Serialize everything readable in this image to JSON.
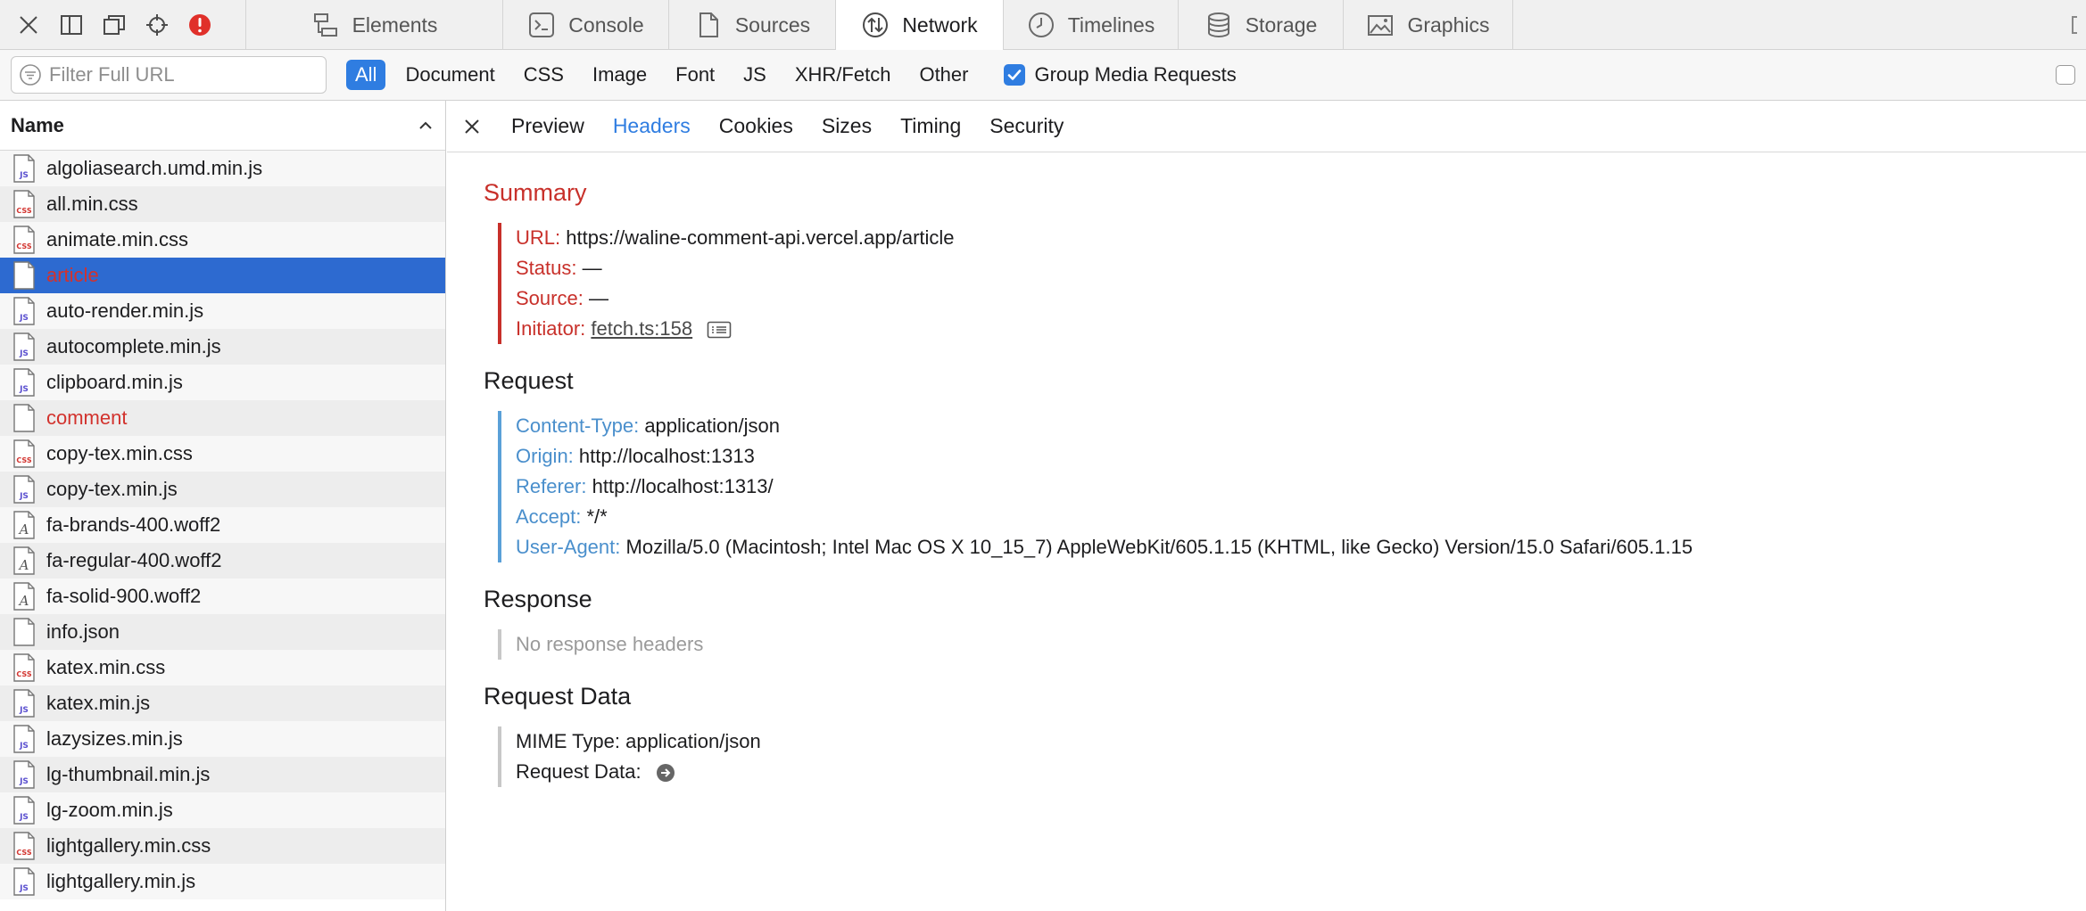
{
  "toolbar": {
    "tabs": [
      {
        "label": "Elements",
        "icon": "elements-icon"
      },
      {
        "label": "Console",
        "icon": "console-icon"
      },
      {
        "label": "Sources",
        "icon": "sources-icon"
      },
      {
        "label": "Network",
        "icon": "network-icon"
      },
      {
        "label": "Timelines",
        "icon": "timelines-icon"
      },
      {
        "label": "Storage",
        "icon": "storage-icon"
      },
      {
        "label": "Graphics",
        "icon": "graphics-icon"
      }
    ],
    "active_tab": "Network",
    "error_color": "#e0302a"
  },
  "filter": {
    "placeholder": "Filter Full URL",
    "types": [
      "All",
      "Document",
      "CSS",
      "Image",
      "Font",
      "JS",
      "XHR/Fetch",
      "Other"
    ],
    "active_type": "All",
    "group_media_label": "Group Media Requests",
    "group_media_checked": true
  },
  "list": {
    "header": "Name",
    "items": [
      {
        "name": "algoliasearch.umd.min.js",
        "type": "js"
      },
      {
        "name": "all.min.css",
        "type": "css"
      },
      {
        "name": "animate.min.css",
        "type": "css"
      },
      {
        "name": "article",
        "type": "doc",
        "selected": true,
        "error": true
      },
      {
        "name": "auto-render.min.js",
        "type": "js"
      },
      {
        "name": "autocomplete.min.js",
        "type": "js"
      },
      {
        "name": "clipboard.min.js",
        "type": "js"
      },
      {
        "name": "comment",
        "type": "doc",
        "error": true
      },
      {
        "name": "copy-tex.min.css",
        "type": "css"
      },
      {
        "name": "copy-tex.min.js",
        "type": "js"
      },
      {
        "name": "fa-brands-400.woff2",
        "type": "font"
      },
      {
        "name": "fa-regular-400.woff2",
        "type": "font"
      },
      {
        "name": "fa-solid-900.woff2",
        "type": "font"
      },
      {
        "name": "info.json",
        "type": "doc"
      },
      {
        "name": "katex.min.css",
        "type": "css"
      },
      {
        "name": "katex.min.js",
        "type": "js"
      },
      {
        "name": "lazysizes.min.js",
        "type": "js"
      },
      {
        "name": "lg-thumbnail.min.js",
        "type": "js"
      },
      {
        "name": "lg-zoom.min.js",
        "type": "js"
      },
      {
        "name": "lightgallery.min.css",
        "type": "css"
      },
      {
        "name": "lightgallery.min.js",
        "type": "js"
      }
    ]
  },
  "details": {
    "tabs": [
      "Preview",
      "Headers",
      "Cookies",
      "Sizes",
      "Timing",
      "Security"
    ],
    "active_tab": "Headers",
    "summary": {
      "title": "Summary",
      "url_label": "URL:",
      "url": "https://waline-comment-api.vercel.app/article",
      "status_label": "Status:",
      "status": "—",
      "source_label": "Source:",
      "source": "—",
      "initiator_label": "Initiator:",
      "initiator": "fetch.ts:158"
    },
    "request": {
      "title": "Request",
      "headers": [
        {
          "key": "Content-Type:",
          "value": "application/json"
        },
        {
          "key": "Origin:",
          "value": "http://localhost:1313"
        },
        {
          "key": "Referer:",
          "value": "http://localhost:1313/"
        },
        {
          "key": "Accept:",
          "value": "*/*"
        },
        {
          "key": "User-Agent:",
          "value": "Mozilla/5.0 (Macintosh; Intel Mac OS X 10_15_7) AppleWebKit/605.1.15 (KHTML, like Gecko) Version/15.0 Safari/605.1.15"
        }
      ]
    },
    "response": {
      "title": "Response",
      "empty": "No response headers"
    },
    "request_data": {
      "title": "Request Data",
      "mime_label": "MIME Type:",
      "mime": "application/json",
      "data_label": "Request Data:"
    }
  }
}
